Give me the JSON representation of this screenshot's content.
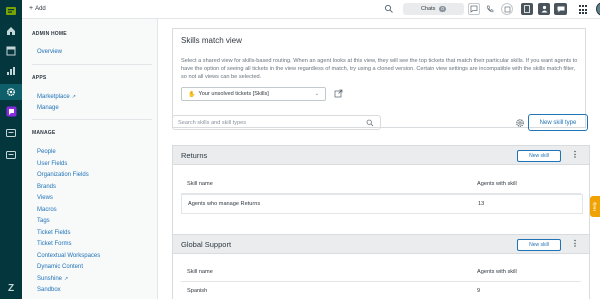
{
  "topbar": {
    "add_label": "Add",
    "chats_label": "Chats",
    "chats_count": "0",
    "icons": [
      "search-icon",
      "message-icon",
      "phone-icon",
      "notes-icon",
      "help-center-icon",
      "user-icon",
      "grid-icon"
    ]
  },
  "sidenav": {
    "admin_home_title": "ADMIN HOME",
    "overview": "Overview",
    "apps_title": "APPS",
    "marketplace": "Marketplace",
    "manage_app": "Manage",
    "manage_title": "MANAGE",
    "manage_items": [
      "People",
      "User Fields",
      "Organization Fields",
      "Brands",
      "Views",
      "Macros",
      "Tags",
      "Ticket Fields",
      "Ticket Forms",
      "Contextual Workspaces",
      "Dynamic Content",
      "Sunshine",
      "Sandbox"
    ]
  },
  "skills_match": {
    "title": "Skills match view",
    "description": "Select a shared view for skills-based routing. When an agent looks at this view, they will see the top tickets that match their particular skills. If you want agents to have the option of seeing all tickets in the view regardless of match, try using a cloned version. Certain view settings are incompatible with the skills match filter, so not all views can be selected.",
    "selected_view": "Your unsolved tickets [Skills]"
  },
  "search": {
    "placeholder": "Search skills and skill types"
  },
  "new_skill_type_label": "New skill type",
  "groups": [
    {
      "title": "Returns",
      "new_skill_label": "New skill",
      "col_skill": "Skill name",
      "col_agents": "Agents with skill",
      "rows": [
        {
          "name": "Agents who manage Returns",
          "agents": "13"
        }
      ]
    },
    {
      "title": "Global Support",
      "new_skill_label": "New skill",
      "col_skill": "Skill name",
      "col_agents": "Agents with skill",
      "rows": [
        {
          "name": "Spanish",
          "agents": "9"
        }
      ]
    }
  ],
  "help_label": "Help",
  "colors": {
    "rail": "#03363d",
    "link": "#1f73b7",
    "help": "#f0a300"
  }
}
